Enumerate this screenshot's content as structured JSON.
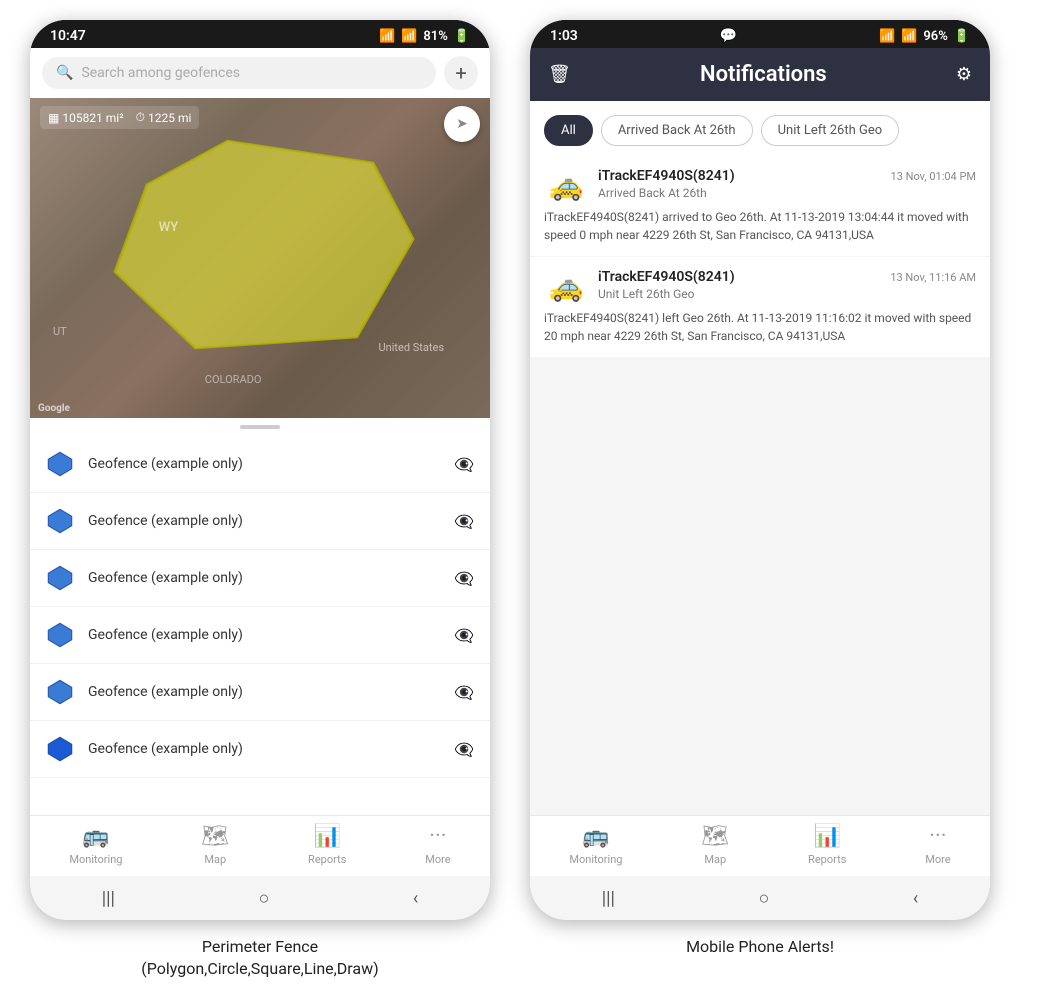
{
  "left_phone": {
    "status_bar": {
      "time": "10:47",
      "wifi": "WiFi",
      "signal": "4G",
      "battery": "81%"
    },
    "search": {
      "placeholder": "Search among geofences"
    },
    "map": {
      "stat1": "105821 mi²",
      "stat2": "1225 mi",
      "label_wy": "WY",
      "label_us": "United States",
      "label_colorado": "COLORADO",
      "label_ut": "UT",
      "google": "Google"
    },
    "geofences": [
      {
        "name": "Geofence (example only)"
      },
      {
        "name": "Geofence (example only)"
      },
      {
        "name": "Geofence (example only)"
      },
      {
        "name": "Geofence (example only)"
      },
      {
        "name": "Geofence (example only)"
      },
      {
        "name": "Geofence (example only)"
      }
    ],
    "bottom_nav": [
      {
        "icon": "🚌",
        "label": "Monitoring"
      },
      {
        "icon": "🗺",
        "label": "Map"
      },
      {
        "icon": "📊",
        "label": "Reports"
      },
      {
        "icon": "•••",
        "label": "More"
      }
    ],
    "sys_nav": [
      "|||",
      "○",
      "<"
    ]
  },
  "right_phone": {
    "status_bar": {
      "time": "1:03",
      "chat": "💬",
      "wifi": "WiFi",
      "signal": "4G",
      "battery": "96%"
    },
    "header": {
      "title": "Notifications",
      "trash_icon": "🗑",
      "settings_icon": "⚙"
    },
    "filter_tabs": [
      {
        "label": "All",
        "active": true
      },
      {
        "label": "Arrived Back At 26th",
        "active": false
      },
      {
        "label": "Unit Left 26th Geo",
        "active": false
      }
    ],
    "notifications": [
      {
        "title": "iTrackEF4940S(8241)",
        "time": "13 Nov, 01:04 PM",
        "subtitle": "Arrived Back At 26th",
        "body": "iTrackEF4940S(8241) arrived to Geo 26th.    At 11-13-2019 13:04:44 it moved with speed 0 mph near 4229 26th St, San Francisco, CA 94131,USA",
        "car_emoji": "🚕"
      },
      {
        "title": "iTrackEF4940S(8241)",
        "time": "13 Nov, 11:16 AM",
        "subtitle": "Unit Left 26th Geo",
        "body": "iTrackEF4940S(8241) left Geo 26th.    At 11-13-2019 11:16:02 it moved with speed 20 mph near 4229 26th St, San Francisco, CA 94131,USA",
        "car_emoji": "🚕"
      }
    ],
    "bottom_nav": [
      {
        "icon": "🚌",
        "label": "Monitoring"
      },
      {
        "icon": "🗺",
        "label": "Map"
      },
      {
        "icon": "📊",
        "label": "Reports"
      },
      {
        "icon": "•••",
        "label": "More"
      }
    ],
    "sys_nav": [
      "|||",
      "○",
      "<"
    ]
  },
  "captions": {
    "left": "Perimeter Fence\n(Polygon,Circle,Square,Line,Draw)",
    "right": "Mobile Phone Alerts!"
  }
}
